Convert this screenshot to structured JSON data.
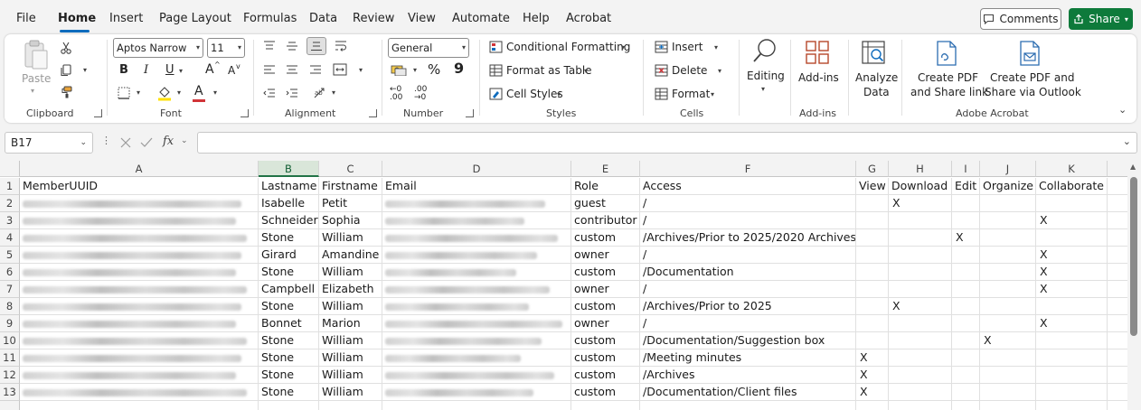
{
  "menu": {
    "items": [
      "File",
      "Home",
      "Insert",
      "Page Layout",
      "Formulas",
      "Data",
      "Review",
      "View",
      "Automate",
      "Help",
      "Acrobat"
    ],
    "active": "Home",
    "comments_label": "Comments",
    "share_label": "Share"
  },
  "ribbon": {
    "clipboard": {
      "paste": "Paste",
      "label": "Clipboard"
    },
    "font": {
      "name": "Aptos Narrow",
      "size": "11",
      "label": "Font",
      "bold": "B",
      "italic": "I",
      "underline": "U",
      "grow": "A",
      "shrink": "A",
      "color": "A"
    },
    "alignment": {
      "label": "Alignment"
    },
    "number": {
      "format": "General",
      "label": "Number",
      "percent": "%",
      "comma": "9",
      "inc": "←0 .00",
      "dec": ".00 →0"
    },
    "styles": {
      "conditional": "Conditional Formatting",
      "format_table": "Format as Table",
      "cell_styles": "Cell Styles",
      "label": "Styles"
    },
    "cells": {
      "insert": "Insert",
      "delete": "Delete",
      "format": "Format",
      "label": "Cells"
    },
    "editing": {
      "label": "Editing"
    },
    "addins": {
      "button": "Add-ins",
      "label": "Add-ins"
    },
    "analyze": {
      "line1": "Analyze",
      "line2": "Data"
    },
    "acrobat": {
      "pdf1_l1": "Create PDF",
      "pdf1_l2": "and Share link",
      "pdf2_l1": "Create PDF and",
      "pdf2_l2": "Share via Outlook",
      "label": "Adobe Acrobat"
    }
  },
  "formula_bar": {
    "cell_ref": "B17",
    "fx": "fx",
    "content": ""
  },
  "sheet": {
    "col_letters": [
      "A",
      "B",
      "C",
      "D",
      "E",
      "F",
      "G",
      "H",
      "I",
      "J",
      "K"
    ],
    "selected_col": "B",
    "row_numbers": [
      "1",
      "2",
      "3",
      "4",
      "5",
      "6",
      "7",
      "8",
      "9",
      "10",
      "11",
      "12",
      "13"
    ],
    "header": [
      "MemberUUID",
      "Lastname",
      "Firstname",
      "Email",
      "Role",
      "Access",
      "View",
      "Download",
      "Edit",
      "Organize",
      "Collaborate"
    ],
    "rows": [
      [
        "",
        "Isabelle",
        "Petit",
        "",
        "guest",
        "/",
        "",
        "X",
        "",
        "",
        ""
      ],
      [
        "",
        "Schneider",
        "Sophia",
        "",
        "contributor",
        "/",
        "",
        "",
        "",
        "",
        "X"
      ],
      [
        "",
        "Stone",
        "William",
        "",
        "custom",
        "/Archives/Prior to 2025/2020 Archives",
        "",
        "",
        "X",
        "",
        ""
      ],
      [
        "",
        "Girard",
        "Amandine",
        "",
        "owner",
        "/",
        "",
        "",
        "",
        "",
        "X"
      ],
      [
        "",
        "Stone",
        "William",
        "",
        "custom",
        "/Documentation",
        "",
        "",
        "",
        "",
        "X"
      ],
      [
        "",
        "Campbell",
        "Elizabeth",
        "",
        "owner",
        "/",
        "",
        "",
        "",
        "",
        "X"
      ],
      [
        "",
        "Stone",
        "William",
        "",
        "custom",
        "/Archives/Prior to 2025",
        "",
        "X",
        "",
        "",
        ""
      ],
      [
        "",
        "Bonnet",
        "Marion",
        "",
        "owner",
        "/",
        "",
        "",
        "",
        "",
        "X"
      ],
      [
        "",
        "Stone",
        "William",
        "",
        "custom",
        "/Documentation/Suggestion box",
        "",
        "",
        "",
        "X",
        ""
      ],
      [
        "",
        "Stone",
        "William",
        "",
        "custom",
        "/Meeting minutes",
        "X",
        "",
        "",
        "",
        ""
      ],
      [
        "",
        "Stone",
        "William",
        "",
        "custom",
        "/Archives",
        "X",
        "",
        "",
        "",
        ""
      ],
      [
        "",
        "Stone",
        "William",
        "",
        "custom",
        "/Documentation/Client files",
        "X",
        "",
        "",
        "",
        ""
      ]
    ]
  }
}
